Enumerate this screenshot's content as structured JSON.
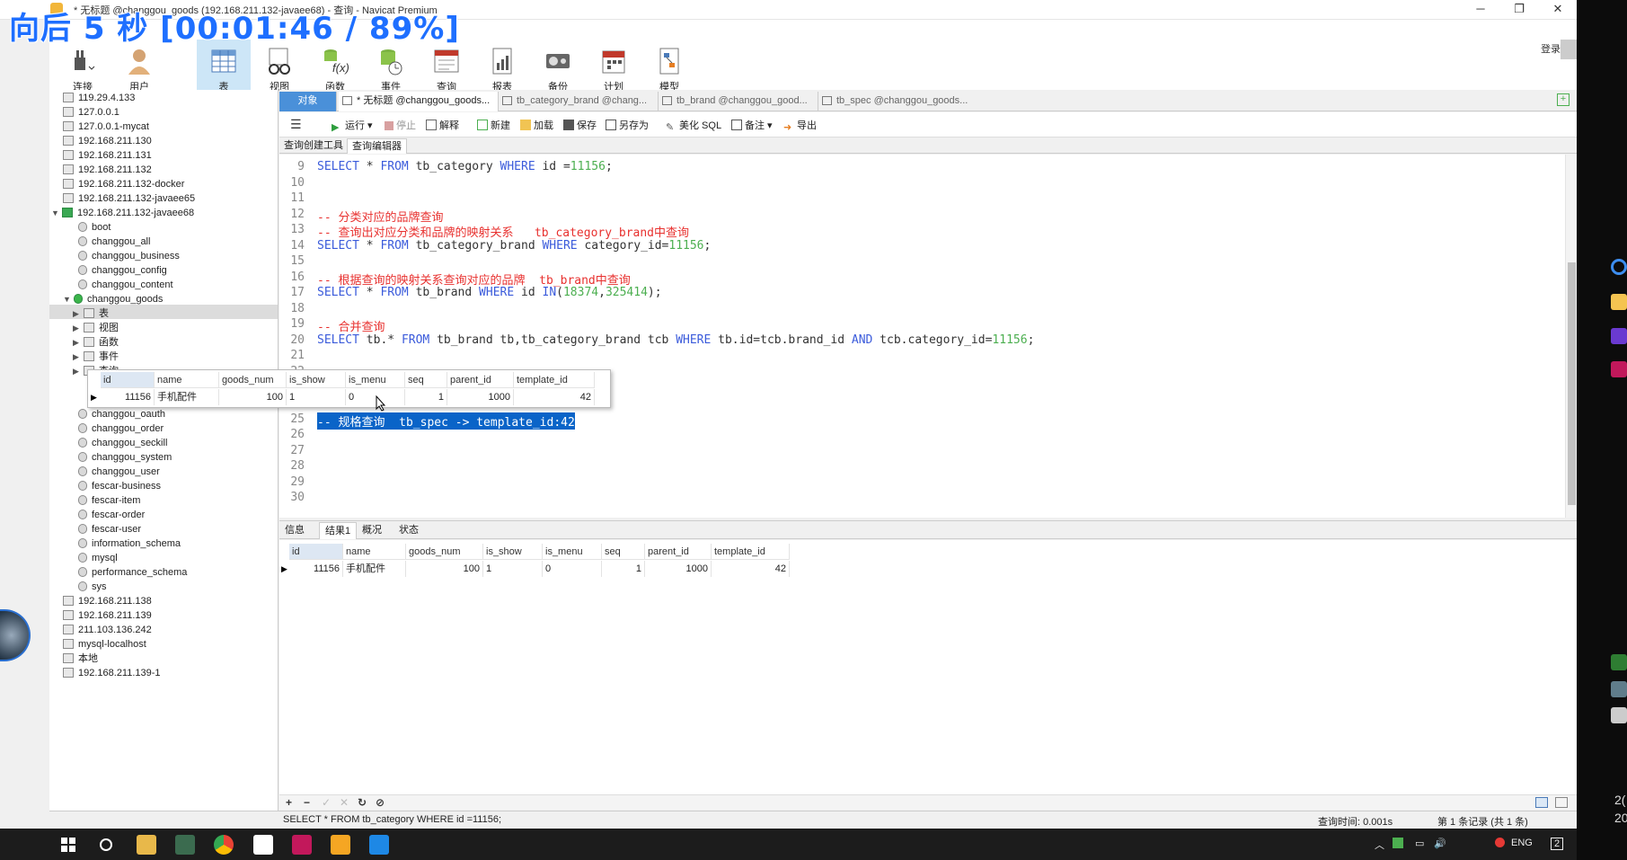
{
  "overlay": {
    "text": "向后 5 秒 [00:01:46 / 89%]"
  },
  "window": {
    "title": "* 无标题 @changgou_goods (192.168.211.132-javaee68) - 查询 - Navicat Premium",
    "minimize": "─",
    "restore": "❐",
    "close": "✕"
  },
  "toolbar": {
    "buttons": [
      {
        "label": "连接",
        "icon": "plug-icon"
      },
      {
        "label": "用户",
        "icon": "user-icon"
      },
      {
        "label": "表",
        "icon": "table-icon"
      },
      {
        "label": "视图",
        "icon": "view-icon"
      },
      {
        "label": "函数",
        "icon": "function-icon"
      },
      {
        "label": "事件",
        "icon": "event-icon"
      },
      {
        "label": "查询",
        "icon": "query-icon"
      },
      {
        "label": "报表",
        "icon": "report-icon"
      },
      {
        "label": "备份",
        "icon": "backup-icon"
      },
      {
        "label": "计划",
        "icon": "schedule-icon"
      },
      {
        "label": "模型",
        "icon": "model-icon"
      }
    ],
    "login": "登录"
  },
  "nav": {
    "items": [
      "119.29.4.133",
      "127.0.0.1",
      "127.0.0.1-mycat",
      "192.168.211.130",
      "192.168.211.131",
      "192.168.211.132",
      "192.168.211.132-docker",
      "192.168.211.132-javaee65",
      "192.168.211.132-javaee68",
      "boot",
      "changgou_all",
      "changgou_business",
      "changgou_config",
      "changgou_content",
      "changgou_goods",
      "表",
      "视图",
      "函数",
      "事件",
      "查询",
      "changgou_oauth",
      "changgou_order",
      "changgou_seckill",
      "changgou_system",
      "changgou_user",
      "fescar-business",
      "fescar-item",
      "fescar-order",
      "fescar-user",
      "information_schema",
      "mysql",
      "performance_schema",
      "sys",
      "192.168.211.138",
      "192.168.211.139",
      "211.103.136.242",
      "mysql-localhost",
      "本地",
      "192.168.211.139-1"
    ]
  },
  "tabs": [
    "对象",
    "* 无标题 @changgou_goods...",
    "tb_category_brand @chang...",
    "tb_brand @changgou_good...",
    "tb_spec @changgou_goods..."
  ],
  "editor_toolbar": {
    "run": "运行",
    "stop": "停止",
    "explain": "解释",
    "new": "新建",
    "load": "加载",
    "save": "保存",
    "save_as": "另存为",
    "beautify": "美化 SQL",
    "comment": "备注",
    "export": "导出"
  },
  "subtabs": [
    "查询创建工具",
    "查询编辑器"
  ],
  "code": {
    "lines": [
      {
        "n": "9",
        "t": "SELECT * FROM tb_category WHERE id =11156;"
      },
      {
        "n": "10",
        "t": ""
      },
      {
        "n": "11",
        "t": ""
      },
      {
        "n": "12",
        "t": "-- 分类对应的品牌查询"
      },
      {
        "n": "13",
        "t": "-- 查询出对应分类和品牌的映射关系   tb_category_brand中查询"
      },
      {
        "n": "14",
        "t": "SELECT * FROM tb_category_brand WHERE category_id=11156;"
      },
      {
        "n": "15",
        "t": ""
      },
      {
        "n": "16",
        "t": "-- 根据查询的映射关系查询对应的品牌  tb_brand中查询"
      },
      {
        "n": "17",
        "t": "SELECT * FROM tb_brand WHERE id IN(18374,325414);"
      },
      {
        "n": "18",
        "t": ""
      },
      {
        "n": "19",
        "t": "-- 合并查询"
      },
      {
        "n": "20",
        "t": "SELECT tb.* FROM tb_brand tb,tb_category_brand tcb WHERE tb.id=tcb.brand_id AND tcb.category_id=11156;"
      },
      {
        "n": "21",
        "t": ""
      },
      {
        "n": "22",
        "t": ""
      },
      {
        "n": "23",
        "t": ""
      },
      {
        "n": "24",
        "t": ""
      },
      {
        "n": "25",
        "t": "-- 规格查询  tb_spec -> template_id:42"
      },
      {
        "n": "26",
        "t": ""
      },
      {
        "n": "27",
        "t": ""
      },
      {
        "n": "28",
        "t": ""
      },
      {
        "n": "29",
        "t": ""
      },
      {
        "n": "30",
        "t": ""
      }
    ]
  },
  "grid": {
    "columns": [
      "id",
      "name",
      "goods_num",
      "is_show",
      "is_menu",
      "seq",
      "parent_id",
      "template_id"
    ],
    "row": [
      "11156",
      "手机配件",
      "100",
      "1",
      "0",
      "1",
      "1000",
      "42"
    ]
  },
  "result_tabs": [
    "信息",
    "结果1",
    "概况",
    "状态"
  ],
  "result_bar": {
    "add": "+",
    "remove": "−",
    "apply": "✓",
    "discard": "✕",
    "refresh": "↻",
    "stop": "⊘"
  },
  "status": {
    "sql": "SELECT * FROM tb_category WHERE id =11156;",
    "query_time": "查询时间: 0.001s",
    "records": "第 1 条记录 (共 1 条)"
  },
  "taskbar": {
    "lang": "ENG",
    "notif": "2"
  },
  "right_strip": {
    "t1": "2(",
    "t2": "20"
  },
  "colors": {
    "accent": "#4a90d9",
    "keyword": "#3b5bdb",
    "number": "#4caf50",
    "comment": "#e8312f",
    "selection": "#0a64c8"
  }
}
